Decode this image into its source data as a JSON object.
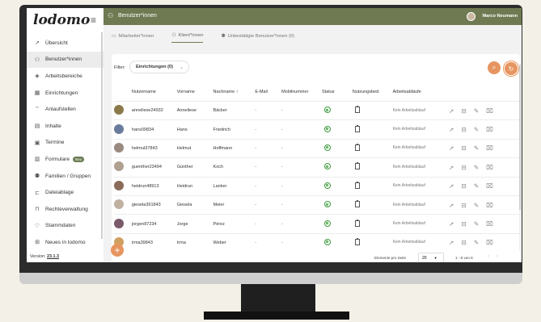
{
  "app": {
    "logo": "lodomo",
    "version_label": "Version:",
    "version_value": "23.1.3"
  },
  "topbar": {
    "title": "Benutzer*innen",
    "username": "Marco Neumann"
  },
  "sidebar": {
    "items": [
      {
        "label": "Übersicht",
        "icon": "rocket-icon",
        "glyph": "➚"
      },
      {
        "label": "Benutzer*innen",
        "icon": "users-icon",
        "glyph": "⚇"
      },
      {
        "label": "Arbeitsbereiche",
        "icon": "layers-icon",
        "glyph": "◈"
      },
      {
        "label": "Einrichtungen",
        "icon": "building-icon",
        "glyph": "▦"
      },
      {
        "label": "Anlaufstellen",
        "icon": "signal-icon",
        "glyph": "⌔"
      },
      {
        "label": "Inhalte",
        "icon": "content-icon",
        "glyph": "▤"
      },
      {
        "label": "Termine",
        "icon": "calendar-icon",
        "glyph": "▣"
      },
      {
        "label": "Formulare",
        "icon": "form-icon",
        "glyph": "▥",
        "badge": "Neu"
      },
      {
        "label": "Familien / Gruppen",
        "icon": "family-icon",
        "glyph": "⚉"
      },
      {
        "label": "Dateiablage",
        "icon": "folder-icon",
        "glyph": "⊏"
      },
      {
        "label": "Rechteverwaltung",
        "icon": "lock-icon",
        "glyph": "⊓"
      },
      {
        "label": "Stammdaten",
        "icon": "heart-icon",
        "glyph": "♡"
      },
      {
        "label": "Neues in lodomo",
        "icon": "gift-icon",
        "glyph": "⊞"
      }
    ]
  },
  "tabs": [
    {
      "label": "Mitarbeiter*innen"
    },
    {
      "label": "Klient*innen"
    },
    {
      "label": "Unbestätigte Benutzer*innen (0)"
    }
  ],
  "filter": {
    "label": "Filter:",
    "value": "Einrichtungen (0)"
  },
  "table": {
    "headers": [
      "Nutzername",
      "Vorname",
      "Nachname",
      "E-Mail",
      "Mobilnummer",
      "Status",
      "Nutzungsbed.",
      "Arbeitsabläufe"
    ],
    "sort_arrow": "↑",
    "rows": [
      {
        "username": "anneliese24932",
        "first": "Anneliese",
        "last": "Bäcker",
        "email": "-",
        "mobile": "-",
        "workflow": "Kein Arbeitsablauf",
        "avatar_color": "#8a7a4a"
      },
      {
        "username": "hans09834",
        "first": "Hans",
        "last": "Friedrich",
        "email": "-",
        "mobile": "-",
        "workflow": "Kein Arbeitsablauf",
        "avatar_color": "#6a7a9a"
      },
      {
        "username": "helmut37843",
        "first": "Helmut",
        "last": "Hoffmann",
        "email": "-",
        "mobile": "-",
        "workflow": "Kein Arbeitsablauf",
        "avatar_color": "#9a8a80"
      },
      {
        "username": "guenther23494",
        "first": "Günther",
        "last": "Koch",
        "email": "-",
        "mobile": "-",
        "workflow": "Kein Arbeitsablauf",
        "avatar_color": "#b0a090"
      },
      {
        "username": "heidrun48913",
        "first": "Heidrun",
        "last": "Lanker",
        "email": "-",
        "mobile": "-",
        "workflow": "Kein Arbeitsablauf",
        "avatar_color": "#8a6a5a"
      },
      {
        "username": "giesela391843",
        "first": "Giesela",
        "last": "Meier",
        "email": "-",
        "mobile": "-",
        "workflow": "Kein Arbeitsablauf",
        "avatar_color": "#c0b0a0"
      },
      {
        "username": "jorgen87234",
        "first": "Jorge",
        "last": "Pérez",
        "email": "-",
        "mobile": "-",
        "workflow": "Kein Arbeitsablauf",
        "avatar_color": "#7a5a6a"
      },
      {
        "username": "irma39843",
        "first": "Irma",
        "last": "Weber",
        "email": "-",
        "mobile": "-",
        "workflow": "Kein Arbeitsablauf",
        "avatar_color": "#d0a060"
      }
    ]
  },
  "pagination": {
    "label": "Elemente pro Seite",
    "per_page": "20",
    "range": "1 - 8 von 8"
  },
  "colors": {
    "topbar": "#6f7a52",
    "accent": "#e69560",
    "status_ok": "#3a9a3a"
  }
}
